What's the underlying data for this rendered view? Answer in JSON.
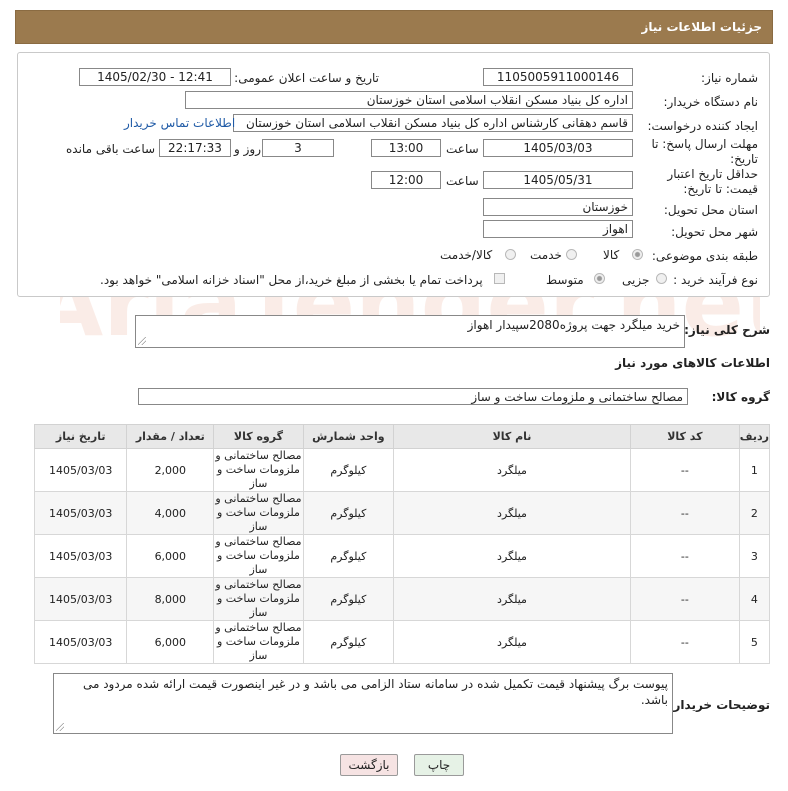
{
  "header": {
    "title": "جزئیات اطلاعات نیاز"
  },
  "form": {
    "need_number_label": "شماره نیاز:",
    "need_number": "1105005911000146",
    "announce_label": "تاریخ و ساعت اعلان عمومی:",
    "announce_value": "1405/02/30 - 12:41",
    "buyer_org_label": "نام دستگاه خریدار:",
    "buyer_org": "اداره کل بنیاد مسکن انقلاب اسلامی استان خوزستان",
    "creator_label": "ایجاد کننده درخواست:",
    "creator": "قاسم دهقانی کارشناس اداره کل بنیاد مسکن انقلاب اسلامی استان خوزستان",
    "contact_link": "اطلاعات تماس خریدار",
    "deadline_label": "مهلت ارسال پاسخ: تا تاریخ:",
    "deadline_date": "1405/03/03",
    "time_label": "ساعت",
    "deadline_time": "13:00",
    "days_value": "3",
    "days_and_label": "روز و",
    "remaining_time": "22:17:33",
    "remaining_label": "ساعت باقی مانده",
    "validity_label": "حداقل تاریخ اعتبار قیمت: تا تاریخ:",
    "validity_date": "1405/05/31",
    "validity_time": "12:00",
    "province_label": "استان محل تحویل:",
    "province": "خوزستان",
    "city_label": "شهر محل تحویل:",
    "city": "اهواز",
    "category_label": "طبقه بندی موضوعی:",
    "category_options": [
      "کالا",
      "خدمت",
      "کالا/خدمت"
    ],
    "process_label": "نوع فرآیند خرید :",
    "process_options": [
      "جزیی",
      "متوسط"
    ],
    "payment_note": "پرداخت تمام یا بخشی از مبلغ خرید،از محل \"اسناد خزانه اسلامی\" خواهد بود."
  },
  "description": {
    "label": "شرح کلی نیاز:",
    "text": "خرید میلگرد جهت پروژه2080سپیدار اهواز"
  },
  "goods_section": {
    "title": "اطلاعات کالاهای مورد نیاز",
    "group_label": "گروه کالا:",
    "group_value": "مصالح ساختمانی و ملزومات ساخت و ساز"
  },
  "table": {
    "headers": [
      "ردیف",
      "کد کالا",
      "نام کالا",
      "واحد شمارش",
      "گروه کالا",
      "تعداد / مقدار",
      "تاریخ نیاز"
    ],
    "rows": [
      [
        "1",
        "--",
        "میلگرد",
        "کیلوگرم",
        "مصالح ساختمانی و ملزومات ساخت و ساز",
        "2,000",
        "1405/03/03"
      ],
      [
        "2",
        "--",
        "میلگرد",
        "کیلوگرم",
        "مصالح ساختمانی و ملزومات ساخت و ساز",
        "4,000",
        "1405/03/03"
      ],
      [
        "3",
        "--",
        "میلگرد",
        "کیلوگرم",
        "مصالح ساختمانی و ملزومات ساخت و ساز",
        "6,000",
        "1405/03/03"
      ],
      [
        "4",
        "--",
        "میلگرد",
        "کیلوگرم",
        "مصالح ساختمانی و ملزومات ساخت و ساز",
        "8,000",
        "1405/03/03"
      ],
      [
        "5",
        "--",
        "میلگرد",
        "کیلوگرم",
        "مصالح ساختمانی و ملزومات ساخت و ساز",
        "6,000",
        "1405/03/03"
      ]
    ]
  },
  "buyer_notes": {
    "label": "توضیحات خریدار:",
    "text": "پیوست برگ پیشنهاد قیمت تکمیل شده در سامانه ستاد الزامی می باشد و در غیر اینصورت  قیمت ارائه شده مردود می باشد."
  },
  "buttons": {
    "print": "چاپ",
    "back": "بازگشت"
  },
  "watermark": {
    "text": "AriaTender.net"
  }
}
